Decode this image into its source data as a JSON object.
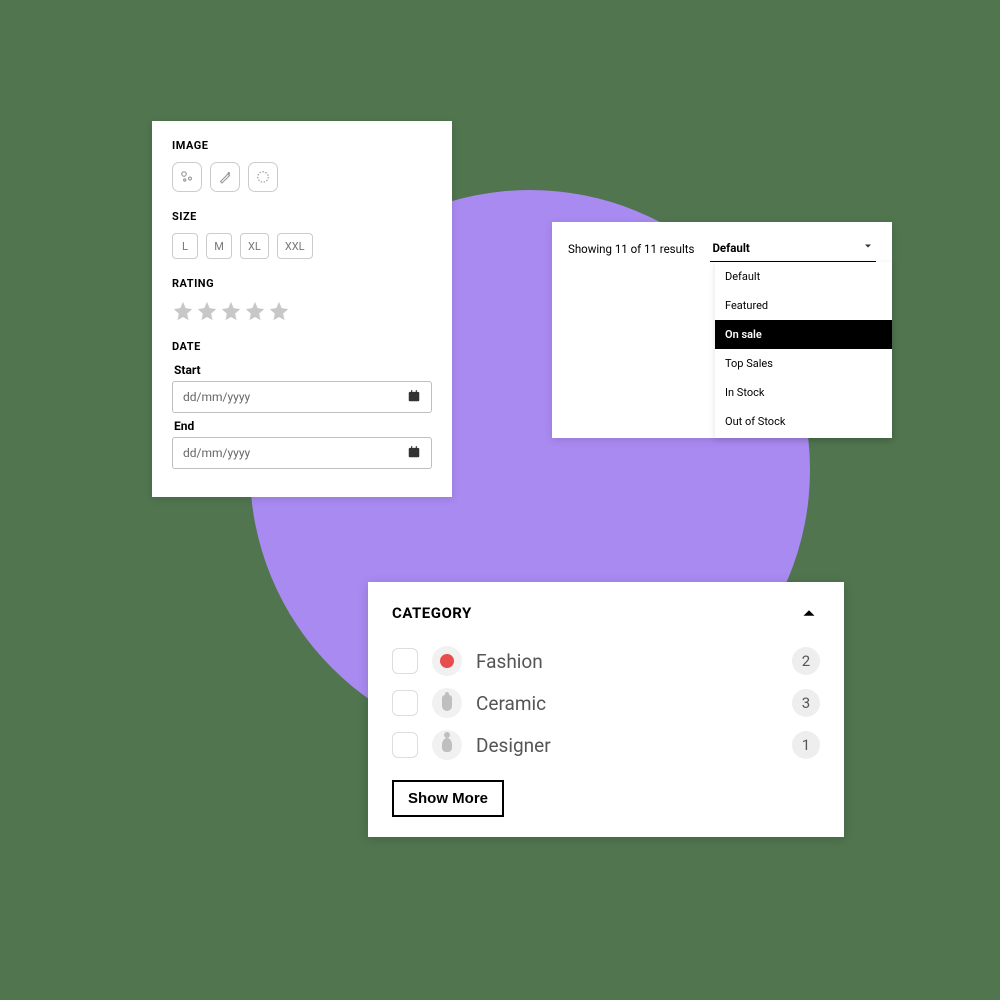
{
  "filters": {
    "image_title": "IMAGE",
    "size_title": "SIZE",
    "sizes": [
      "L",
      "M",
      "XL",
      "XXL"
    ],
    "rating_title": "RATING",
    "date_title": "DATE",
    "start_label": "Start",
    "end_label": "End",
    "date_placeholder": "dd/mm/yyyy"
  },
  "sort": {
    "results_text": "Showing 11 of 11 results",
    "selected": "Default",
    "options": [
      "Default",
      "Featured",
      "On sale",
      "Top Sales",
      "In Stock",
      "Out of Stock"
    ],
    "highlighted": "On sale"
  },
  "category": {
    "title": "CATEGORY",
    "items": [
      {
        "label": "Fashion",
        "count": "2",
        "color": "#e84c4c"
      },
      {
        "label": "Ceramic",
        "count": "3"
      },
      {
        "label": "Designer",
        "count": "1"
      }
    ],
    "show_more": "Show More"
  }
}
